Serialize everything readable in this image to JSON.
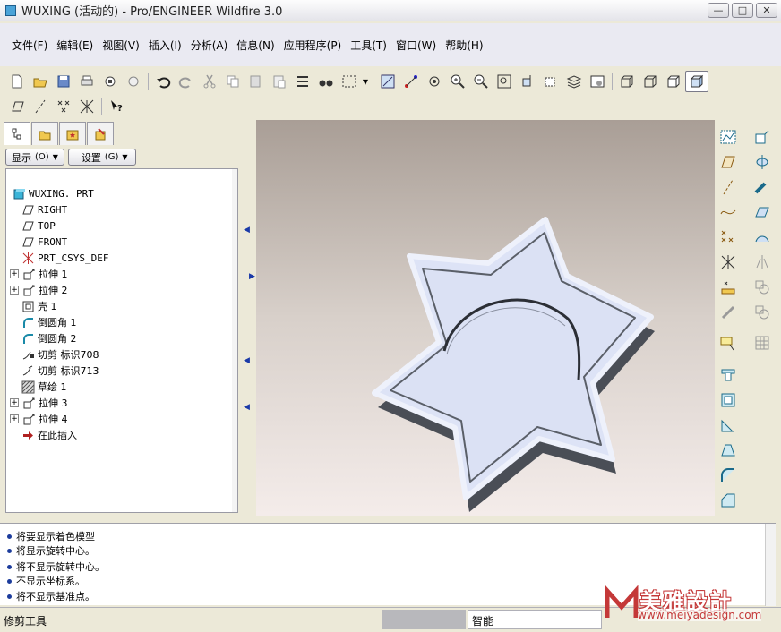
{
  "window": {
    "title": "WUXING (活动的) - Pro/ENGINEER Wildfire 3.0",
    "buttons": [
      "—",
      "□",
      "✕"
    ]
  },
  "menu": [
    "文件(F)",
    "编辑(E)",
    "视图(V)",
    "插入(I)",
    "分析(A)",
    "信息(N)",
    "应用程序(P)",
    "工具(T)",
    "窗口(W)",
    "帮助(H)"
  ],
  "left_panel": {
    "show_button": "显示",
    "show_shortcut": "(O)",
    "settings_button": "设置",
    "settings_shortcut": "(G)",
    "tree": [
      {
        "label": "WUXING. PRT",
        "icon": "part-icon",
        "expand": "none"
      },
      {
        "label": "RIGHT",
        "icon": "datum-plane-icon",
        "expand": "none"
      },
      {
        "label": "TOP",
        "icon": "datum-plane-icon",
        "expand": "none"
      },
      {
        "label": "FRONT",
        "icon": "datum-plane-icon",
        "expand": "none"
      },
      {
        "label": "PRT_CSYS_DEF",
        "icon": "csys-icon",
        "expand": "none"
      },
      {
        "label": "拉伸 1",
        "icon": "extrude-icon",
        "expand": "+"
      },
      {
        "label": "拉伸 2",
        "icon": "extrude-icon",
        "expand": "+"
      },
      {
        "label": "壳 1",
        "icon": "shell-icon",
        "expand": "none"
      },
      {
        "label": "倒圆角 1",
        "icon": "round-icon",
        "expand": "none"
      },
      {
        "label": "倒圆角 2",
        "icon": "round-icon",
        "expand": "none"
      },
      {
        "label": "切剪 标识708",
        "icon": "cut-locked-icon",
        "expand": "none"
      },
      {
        "label": "切剪 标识713",
        "icon": "cut-icon",
        "expand": "none"
      },
      {
        "label": "草绘 1",
        "icon": "sketch-icon",
        "expand": "none"
      },
      {
        "label": "拉伸 3",
        "icon": "extrude-icon",
        "expand": "+"
      },
      {
        "label": "拉伸 4",
        "icon": "extrude-icon",
        "expand": "+"
      },
      {
        "label": "在此插入",
        "icon": "insert-here-arrow-icon",
        "expand": "none"
      }
    ]
  },
  "messages": [
    "将要显示着色模型",
    "将显示旋转中心。",
    "将不显示旋转中心。",
    "不显示坐标系。",
    "将不显示基准点。"
  ],
  "status": {
    "tool": "修剪工具",
    "filter": "智能"
  },
  "watermark": {
    "brand": "美雅設計",
    "url": "www.meiyadesign.com"
  },
  "colors": {
    "part_face": "#dde3f6",
    "part_side": "#4a4e56",
    "viewport_top": "#a99e96",
    "viewport_bottom": "#f4ecea"
  }
}
